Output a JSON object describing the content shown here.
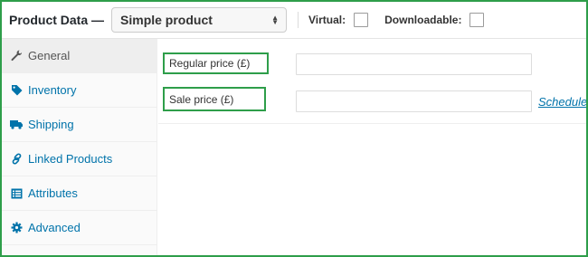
{
  "header": {
    "title": "Product Data —",
    "product_type": "Simple product",
    "virtual_label": "Virtual:",
    "downloadable_label": "Downloadable:"
  },
  "sidebar": {
    "items": [
      {
        "label": "General",
        "icon": "wrench-icon",
        "active": true
      },
      {
        "label": "Inventory",
        "icon": "tag-icon",
        "active": false
      },
      {
        "label": "Shipping",
        "icon": "truck-icon",
        "active": false
      },
      {
        "label": "Linked Products",
        "icon": "link-icon",
        "active": false
      },
      {
        "label": "Attributes",
        "icon": "list-icon",
        "active": false
      },
      {
        "label": "Advanced",
        "icon": "gear-icon",
        "active": false
      }
    ]
  },
  "general": {
    "regular_price_label": "Regular price (£)",
    "regular_price_value": "",
    "sale_price_label": "Sale price (£)",
    "sale_price_value": "",
    "schedule_link": "Schedule"
  },
  "colors": {
    "accent": "#0073aa",
    "highlight_border": "#2e9e4a",
    "text": "#23282d"
  }
}
